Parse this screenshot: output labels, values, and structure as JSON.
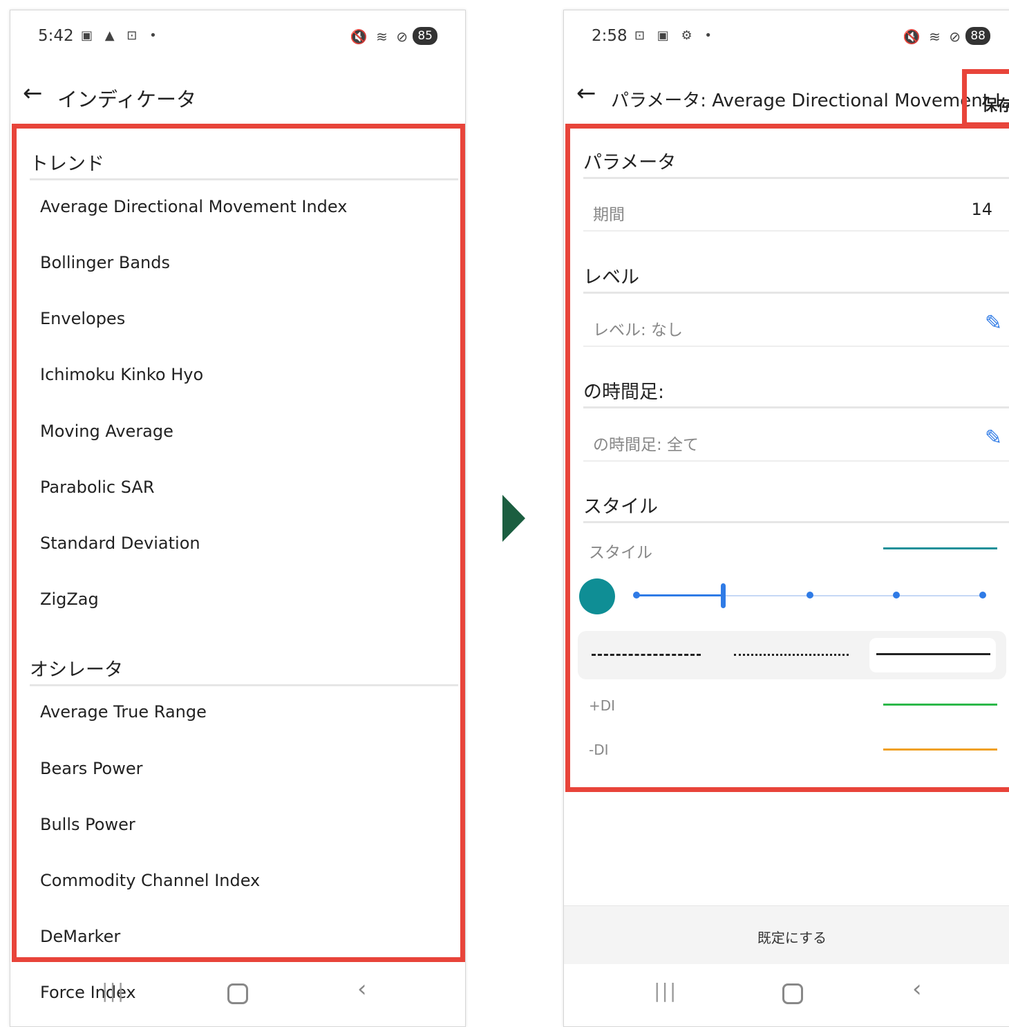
{
  "left_phone": {
    "status": {
      "time": "5:42",
      "battery": "85",
      "left_icons": "▣ ▲ ⊡ •",
      "right_icons": "🔇 ≋ ⊘"
    },
    "title": "インディケータ",
    "sections": [
      {
        "header": "トレンド",
        "items": [
          "Average Directional Movement Index",
          "Bollinger Bands",
          "Envelopes",
          "Ichimoku Kinko Hyo",
          "Moving Average",
          "Parabolic SAR",
          "Standard Deviation",
          "ZigZag"
        ]
      },
      {
        "header": "オシレータ",
        "items": [
          "Average True Range",
          "Bears Power",
          "Bulls Power",
          "Commodity Channel Index",
          "DeMarker",
          "Force Index"
        ]
      }
    ]
  },
  "right_phone": {
    "status": {
      "time": "2:58",
      "battery": "88",
      "left_icons": "⊡ ▣ ⚙ •",
      "right_icons": "🔇 ≋ ⊘"
    },
    "title": "パラメータ: Average Directional Movement I...",
    "save_label": "保存",
    "sections": {
      "params": {
        "header": "パラメータ",
        "label": "期間",
        "value": "14"
      },
      "levels": {
        "header": "レベル",
        "label": "レベル: なし"
      },
      "timeframes": {
        "header": "の時間足:",
        "label": "の時間足: 全て"
      },
      "style": {
        "header": "スタイル",
        "label": "スタイル",
        "color": "#1a9099"
      },
      "plus_di": {
        "label": "+DI",
        "color": "#2cb84a"
      },
      "minus_di": {
        "label": "-DI",
        "color": "#f0a020"
      }
    },
    "reset_label": "既定にする"
  },
  "colors": {
    "highlight": "#e8443a",
    "accent": "#2f7be6",
    "arrow": "#1b5e40",
    "swatch": "#0f8e95"
  }
}
